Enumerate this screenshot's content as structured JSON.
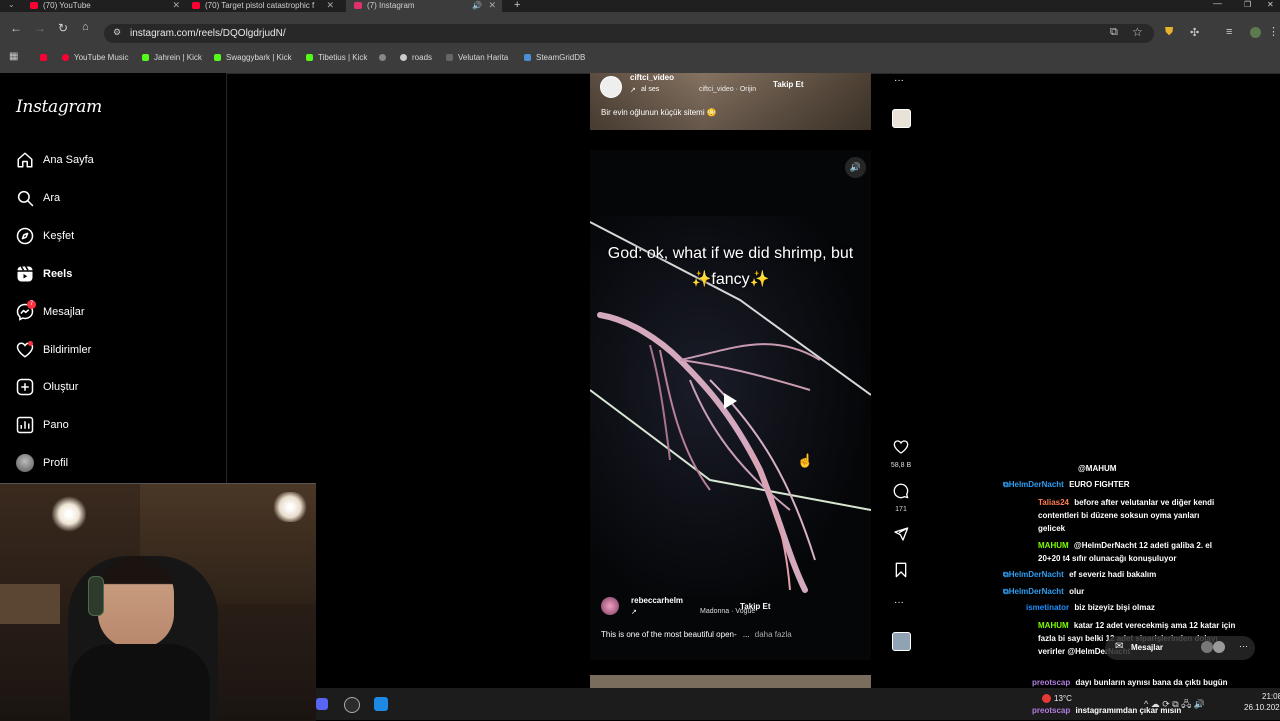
{
  "browser": {
    "tabs": [
      {
        "title": "(70) YouTube",
        "color": "#ff0033"
      },
      {
        "title": "(70) Target pistol catastrophic f",
        "color": "#ff0033"
      },
      {
        "title": "(7) Instagram",
        "color": "#e1306c"
      }
    ],
    "new_tab": "+",
    "url": "instagram.com/reels/DQOlgdrjudN/",
    "bookmarks": [
      "YouTube Music",
      "Jahrein | Kick",
      "Swaggybark | Kick",
      "Tibetius | Kick",
      "roads",
      "Velutan Harita",
      "SteamGridDB"
    ]
  },
  "sidebar": {
    "logo": "Instagram",
    "items": [
      {
        "label": "Ana Sayfa",
        "icon": "home-icon"
      },
      {
        "label": "Ara",
        "icon": "search-icon"
      },
      {
        "label": "Keşfet",
        "icon": "compass-icon"
      },
      {
        "label": "Reels",
        "icon": "reels-icon"
      },
      {
        "label": "Mesajlar",
        "icon": "messenger-icon",
        "badge": "7"
      },
      {
        "label": "Bildirimler",
        "icon": "heart-icon"
      },
      {
        "label": "Oluştur",
        "icon": "plus-square-icon"
      },
      {
        "label": "Pano",
        "icon": "chart-icon"
      },
      {
        "label": "Profil",
        "icon": "avatar-icon"
      }
    ]
  },
  "top_reel": {
    "username": "ciftci_video",
    "audio": "al ses",
    "audio_credit": "ciftci_video · Orijin",
    "follow": "Takip Et",
    "caption": "Bir evin oğlunun küçük sitemi 😳",
    "more": "···"
  },
  "main_reel": {
    "overlay_text_1": "God: ok, what if we did shrimp, but",
    "overlay_text_2": "✨fancy✨",
    "username": "rebeccarhelm",
    "audio_credit": "Madonna · Vogue",
    "follow": "Takip Et",
    "caption": "This is one of the most beautiful open-",
    "caption_ellipsis": "...",
    "more_link": "daha fazla",
    "likes": "58,8 B",
    "comments": "171",
    "more": "···"
  },
  "messages_popup": {
    "label": "Mesajlar",
    "more": "···"
  },
  "chat": [
    {
      "user": "",
      "text": "@MAHUM",
      "color": "#ffffff",
      "badge": false
    },
    {
      "user": "HelmDerNacht",
      "text": "EURO FIGHTER",
      "color": "#2f9cf0",
      "badge": true
    },
    {
      "user": "Talias24",
      "text": "before after velutanlar ve diğer kendi contentleri bi düzene soksun oyma yanları gelicek",
      "color": "#ff7f50",
      "badge": false
    },
    {
      "user": "MAHUM",
      "text": "@HelmDerNacht 12 adeti galiba 2. el 20+20 t4 sıfır olunacağı konuşuluyor",
      "color": "#7fff00",
      "badge": false
    },
    {
      "user": "HelmDerNacht",
      "text": "ef severiz hadi bakalım",
      "color": "#2f9cf0",
      "badge": true
    },
    {
      "user": "HelmDerNacht",
      "text": "olur",
      "color": "#2f9cf0",
      "badge": true
    },
    {
      "user": "ismetinator",
      "text": "biz bizeyiz bişi olmaz",
      "color": "#1e90ff",
      "badge": false
    },
    {
      "user": "MAHUM",
      "text": "katar 12 adet verecekmiş ama 12 katar için fazla bi sayı belki 12 adet siparişlerinden dolayı verirler @HelmDerNacht",
      "color": "#7fff00",
      "badge": false
    },
    {
      "user": "preotscap",
      "text": "dayı bunların aynısı bana da çıktı bugün noluyo",
      "color": "#b27de0",
      "badge": false
    },
    {
      "user": "preotscap",
      "text": "instagramımdan çıkar mısın",
      "color": "#b27de0",
      "badge": false
    }
  ],
  "system_tray": {
    "temp": "13°C",
    "time": "21:08",
    "date": "26.10.2025"
  }
}
